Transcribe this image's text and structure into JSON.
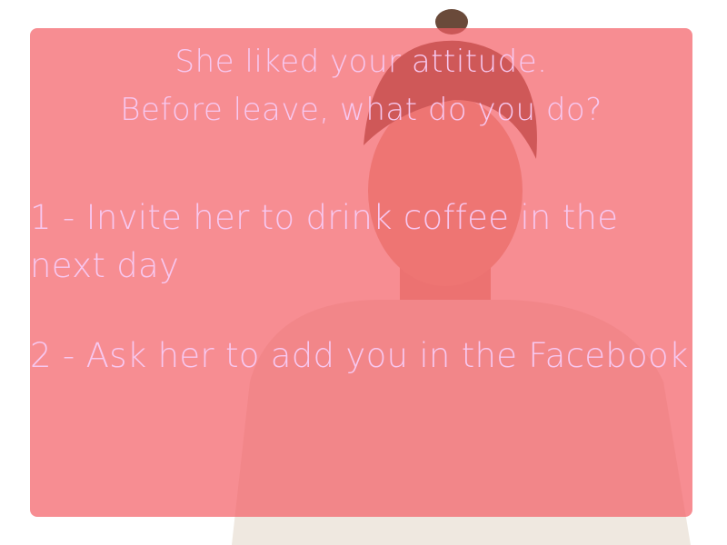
{
  "prompt": {
    "line1": "She liked your attitude.",
    "line2": "Before leave, what do you do?"
  },
  "choices": [
    {
      "label": "1 - Invite her to drink coffee in the next day"
    },
    {
      "label": "2 - Ask her to add you in the Facebook"
    }
  ],
  "colors": {
    "panel_overlay": "#F35C64",
    "text": "#F7C8F0"
  }
}
